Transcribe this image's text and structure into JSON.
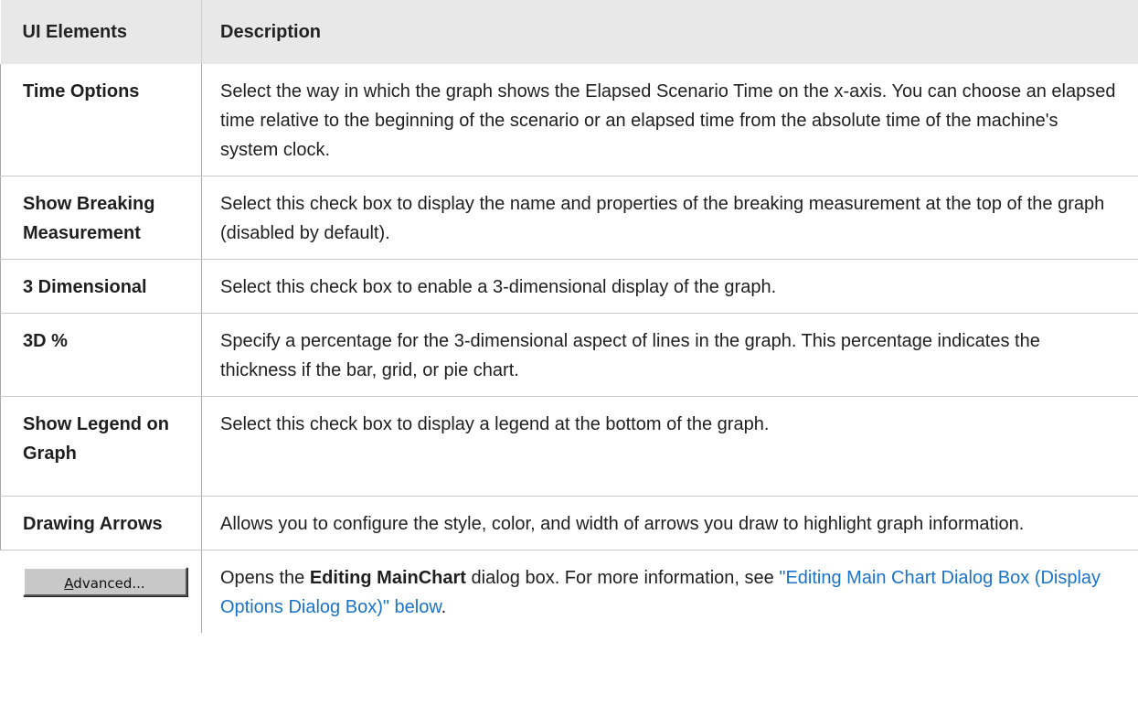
{
  "header": {
    "col1": "UI Elements",
    "col2": "Description"
  },
  "rows": [
    {
      "element": "Time Options",
      "description": "Select the way in which the graph shows the Elapsed Scenario Time on the x-axis. You can choose an elapsed time relative to the beginning of the scenario or an elapsed time from the absolute time of the machine's system clock."
    },
    {
      "element": "Show Breaking Measurement",
      "description": "Select this check box to display the name and properties of the breaking measurement at the top of the graph (disabled by default)."
    },
    {
      "element": "3 Dimensional",
      "description": "Select this check box to enable a 3-dimensional display of the graph."
    },
    {
      "element": "3D %",
      "description": "Specify a percentage for the 3-dimensional aspect of lines in the graph. This percentage indicates the thickness if the bar, grid, or pie chart."
    },
    {
      "element": "Show Legend on Graph",
      "description": "Select this check box to display a legend at the bottom of the graph."
    },
    {
      "element": "Drawing Arrows",
      "description": "Allows you to configure the style, color, and width of arrows you draw to highlight graph information."
    }
  ],
  "advanced_row": {
    "button_label_first": "A",
    "button_label_rest": "dvanced...",
    "desc_prefix": "Opens the ",
    "desc_bold": "Editing MainChart",
    "desc_middle": " dialog box. For more information, see ",
    "desc_link": "\"Editing Main Chart Dialog Box (Display Options Dialog Box)\" below",
    "desc_suffix": "."
  },
  "colors": {
    "header_bg": "#e8e8e8",
    "link": "#1a73c9",
    "border": "#c8c8c8"
  }
}
